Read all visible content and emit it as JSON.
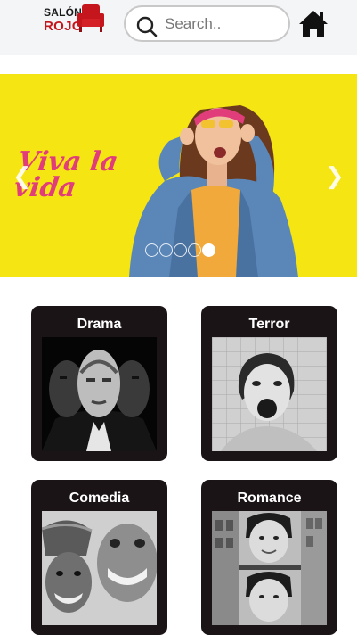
{
  "header": {
    "logo_line1": "SALÓN",
    "logo_line2": "ROJO",
    "search_placeholder": "Search..",
    "home_icon": "home-icon"
  },
  "banner": {
    "tagline_line1": "Viva la",
    "tagline_line2": "vida",
    "prev_icon": "chevron-left-icon",
    "next_icon": "chevron-right-icon",
    "slides": 5,
    "active_slide": 5
  },
  "categories": [
    {
      "title": "Drama"
    },
    {
      "title": "Terror"
    },
    {
      "title": "Comedia"
    },
    {
      "title": "Romance"
    }
  ],
  "colors": {
    "brand_red": "#c4161c",
    "banner_yellow": "#f5e513",
    "card_bg": "#1b1416",
    "tagline_pink": "#e23d7b"
  }
}
